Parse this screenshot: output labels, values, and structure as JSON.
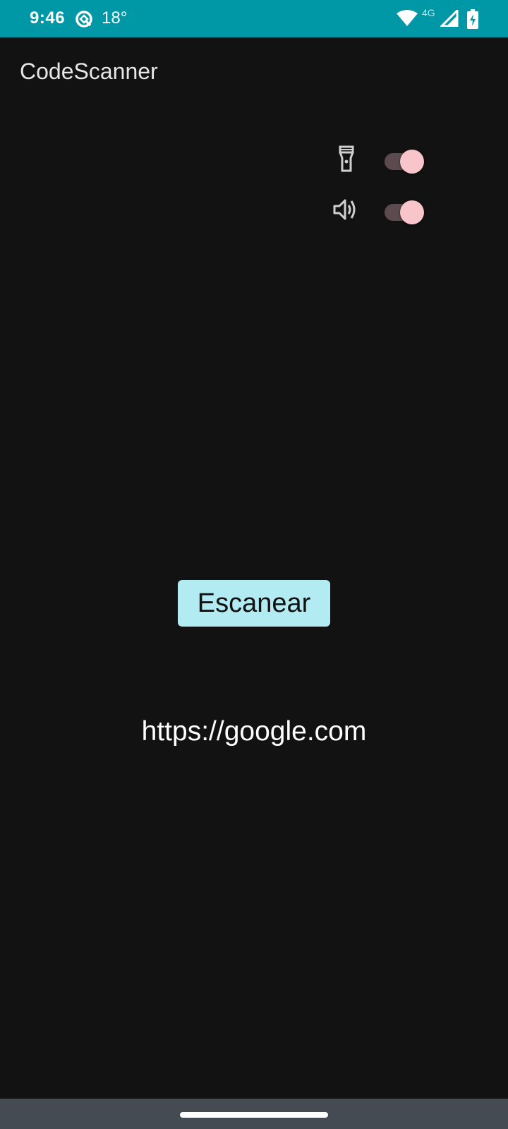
{
  "status_bar": {
    "time": "9:46",
    "temperature": "18°",
    "network": "4G",
    "background": "#0097a7"
  },
  "app_bar": {
    "title": "CodeScanner"
  },
  "toggles": {
    "flashlight": {
      "icon": "flashlight-icon",
      "on": true
    },
    "sound": {
      "icon": "volume-icon",
      "on": true
    },
    "thumb_color": "#f8c5ca",
    "track_color": "#5c4b4e"
  },
  "main": {
    "scan_button_label": "Escanear",
    "result_text": "https://google.com",
    "button_color": "#b2ebf2"
  }
}
